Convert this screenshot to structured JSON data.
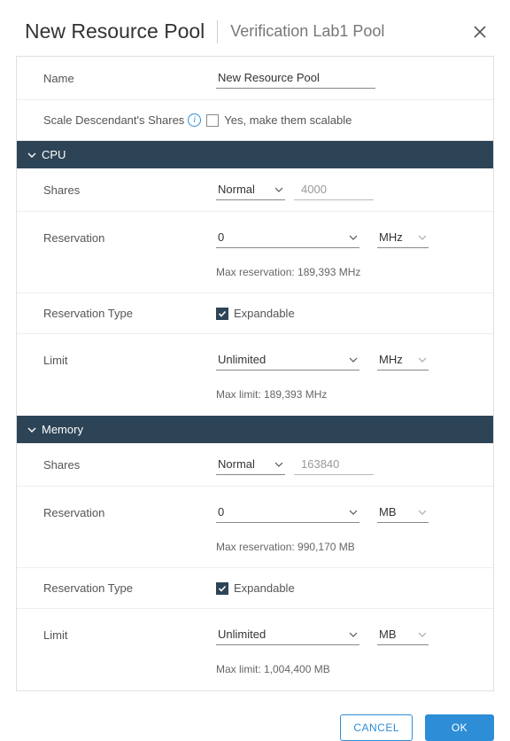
{
  "header": {
    "title": "New Resource Pool",
    "subtitle": "Verification Lab1 Pool"
  },
  "form": {
    "name": {
      "label": "Name",
      "value": "New Resource Pool"
    },
    "scale": {
      "label": "Scale Descendant's Shares",
      "checkbox_label": "Yes, make them scalable",
      "checked": false
    }
  },
  "sections": {
    "cpu": {
      "title": "CPU",
      "shares": {
        "label": "Shares",
        "level": "Normal",
        "value": "4000"
      },
      "reservation": {
        "label": "Reservation",
        "value": "0",
        "unit": "MHz",
        "hint": "Max reservation: 189,393 MHz"
      },
      "reservation_type": {
        "label": "Reservation Type",
        "expandable_label": "Expandable",
        "checked": true
      },
      "limit": {
        "label": "Limit",
        "value": "Unlimited",
        "unit": "MHz",
        "hint": "Max limit: 189,393 MHz"
      }
    },
    "memory": {
      "title": "Memory",
      "shares": {
        "label": "Shares",
        "level": "Normal",
        "value": "163840"
      },
      "reservation": {
        "label": "Reservation",
        "value": "0",
        "unit": "MB",
        "hint": "Max reservation: 990,170 MB"
      },
      "reservation_type": {
        "label": "Reservation Type",
        "expandable_label": "Expandable",
        "checked": true
      },
      "limit": {
        "label": "Limit",
        "value": "Unlimited",
        "unit": "MB",
        "hint": "Max limit: 1,004,400 MB"
      }
    }
  },
  "footer": {
    "cancel": "Cancel",
    "ok": "OK"
  }
}
